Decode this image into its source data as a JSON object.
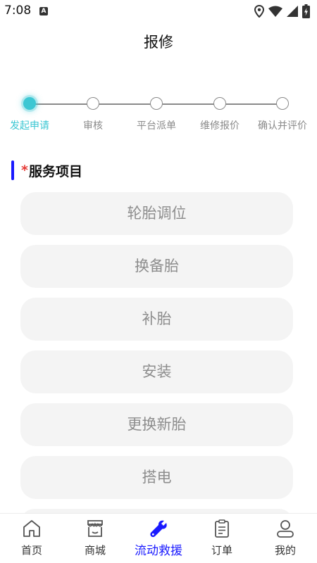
{
  "status_bar": {
    "time": "7:08",
    "notification_glyph": "A"
  },
  "page": {
    "title": "报修"
  },
  "stepper": {
    "steps": [
      {
        "label": "发起申请",
        "active": true
      },
      {
        "label": "审核",
        "active": false
      },
      {
        "label": "平台派单",
        "active": false
      },
      {
        "label": "维修报价",
        "active": false
      },
      {
        "label": "确认并评价",
        "active": false
      }
    ]
  },
  "section": {
    "required_mark": "*",
    "title": "服务项目"
  },
  "services": [
    {
      "label": "轮胎调位"
    },
    {
      "label": "换备胎"
    },
    {
      "label": "补胎"
    },
    {
      "label": "安装"
    },
    {
      "label": "更换新胎"
    },
    {
      "label": "搭电"
    }
  ],
  "bottom_nav": {
    "items": [
      {
        "label": "首页",
        "icon": "home-icon"
      },
      {
        "label": "商城",
        "icon": "store-icon"
      },
      {
        "label": "流动救援",
        "icon": "wrench-icon",
        "active": true
      },
      {
        "label": "订单",
        "icon": "clipboard-icon"
      },
      {
        "label": "我的",
        "icon": "user-icon"
      }
    ]
  },
  "colors": {
    "active_step": "#3cc7d3",
    "accent_blue": "#1a1aff",
    "required_red": "#e53935",
    "service_bg": "#f4f4f4"
  }
}
